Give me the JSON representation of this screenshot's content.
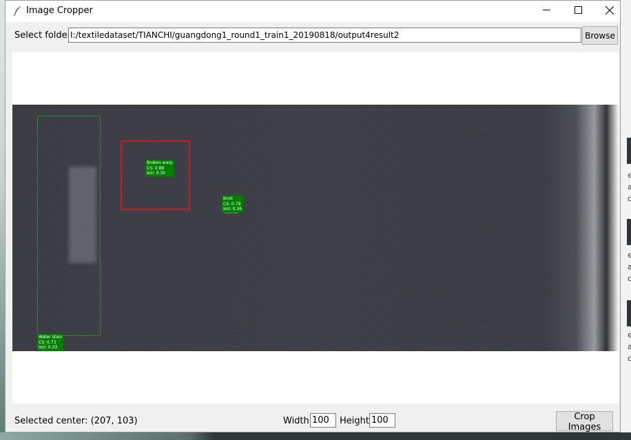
{
  "window": {
    "title": "Image Cropper",
    "controls": {
      "minimize": "─",
      "maximize": "☐",
      "close": "✕"
    }
  },
  "folder": {
    "label": "Select folder:",
    "path": "I:/textiledataset/TIANCHI/guangdong1_round1_train1_20190818/output4result2",
    "browse_label": "Browse"
  },
  "image": {
    "detections": [
      {
        "label": "Broken warp",
        "cs": "CS: 0.88",
        "iou": "IoU: 0.32"
      },
      {
        "label": "Knot",
        "cs": "CS: 0.79",
        "iou": "IoU: 0.26"
      },
      {
        "label": "Water stain",
        "cs": "CS: 0.73",
        "iou": "IoU: 0.33"
      }
    ]
  },
  "status": {
    "selected_center": "Selected center: (207, 103)",
    "width_label": "Width:",
    "width_value": "100",
    "height_label": "Height:",
    "height_value": "100",
    "crop_label": "Crop Images"
  },
  "background_window": {
    "fragments": [
      "e",
      "a",
      "c",
      "e",
      "a",
      "c",
      "e",
      "a",
      "c"
    ]
  },
  "colors": {
    "selection": "#d11a1a",
    "detection_label": "#008000",
    "ground_truth": "#2c8a2c"
  },
  "icons": [
    "feather-icon",
    "minimize-icon",
    "maximize-icon",
    "close-icon"
  ]
}
